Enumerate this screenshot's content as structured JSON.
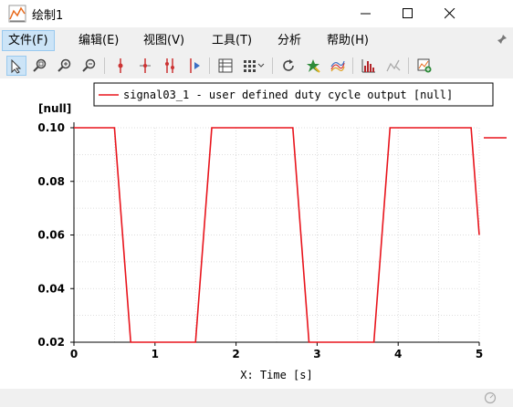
{
  "window": {
    "title": "绘制1"
  },
  "menu": {
    "items": [
      {
        "label": "文件(F)"
      },
      {
        "label": "编辑(E)"
      },
      {
        "label": "视图(V)"
      },
      {
        "label": "工具(T)"
      },
      {
        "label": "分析"
      },
      {
        "label": "帮助(H)"
      }
    ]
  },
  "toolbar": {
    "icons": [
      "select-arrow-icon",
      "zoom-region-icon",
      "zoom-in-icon",
      "zoom-out-icon",
      "cursor-marker-icon",
      "cross-marker-icon",
      "two-cursors-icon",
      "cursor-play-icon",
      "table-icon",
      "grid-layout-icon",
      "refresh-icon",
      "star-icon",
      "color-curves-icon",
      "histogram-icon",
      "magic-icon",
      "add-plot-icon"
    ]
  },
  "colors": {
    "series": "#e8141c",
    "accent": "#cce4f7"
  },
  "chart_data": {
    "type": "line",
    "ylabel": "[null]",
    "xlabel": "X: Time [s]",
    "xlim": [
      0,
      5
    ],
    "ylim": [
      0.02,
      0.1
    ],
    "x_ticks": [
      "0",
      "1",
      "2",
      "3",
      "4",
      "5"
    ],
    "y_ticks": [
      "0.02",
      "0.04",
      "0.06",
      "0.08",
      "0.10"
    ],
    "grid": true,
    "legend_position": "top",
    "series": [
      {
        "name": "signal03_1 - user defined duty cycle output [null]",
        "x": [
          0,
          0.5,
          0.7,
          1.5,
          1.7,
          2.7,
          2.9,
          3.7,
          3.9,
          4.9,
          5.0
        ],
        "y": [
          0.1,
          0.1,
          0.02,
          0.02,
          0.1,
          0.1,
          0.02,
          0.02,
          0.1,
          0.1,
          0.06
        ]
      }
    ]
  }
}
